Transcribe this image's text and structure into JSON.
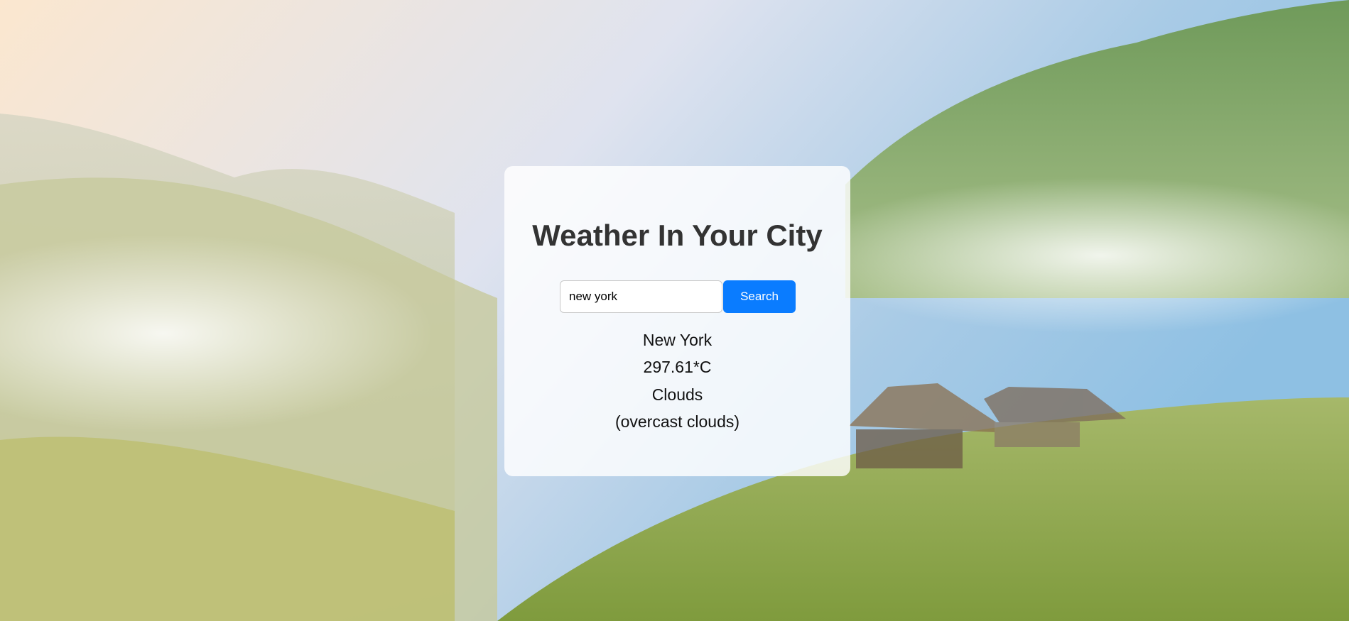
{
  "app": {
    "title": "Weather In Your City"
  },
  "search": {
    "value": "new york",
    "placeholder": "",
    "button_label": "Search"
  },
  "weather": {
    "city": "New York",
    "temperature": "297.61*C",
    "condition": "Clouds",
    "description": "(overcast clouds)"
  },
  "colors": {
    "accent": "#0a7cff",
    "title_text": "#333333",
    "card_background": "rgba(255,255,255,0.82)"
  },
  "background": {
    "subject": "misty-mountain-tea-plantation-with-huts"
  }
}
